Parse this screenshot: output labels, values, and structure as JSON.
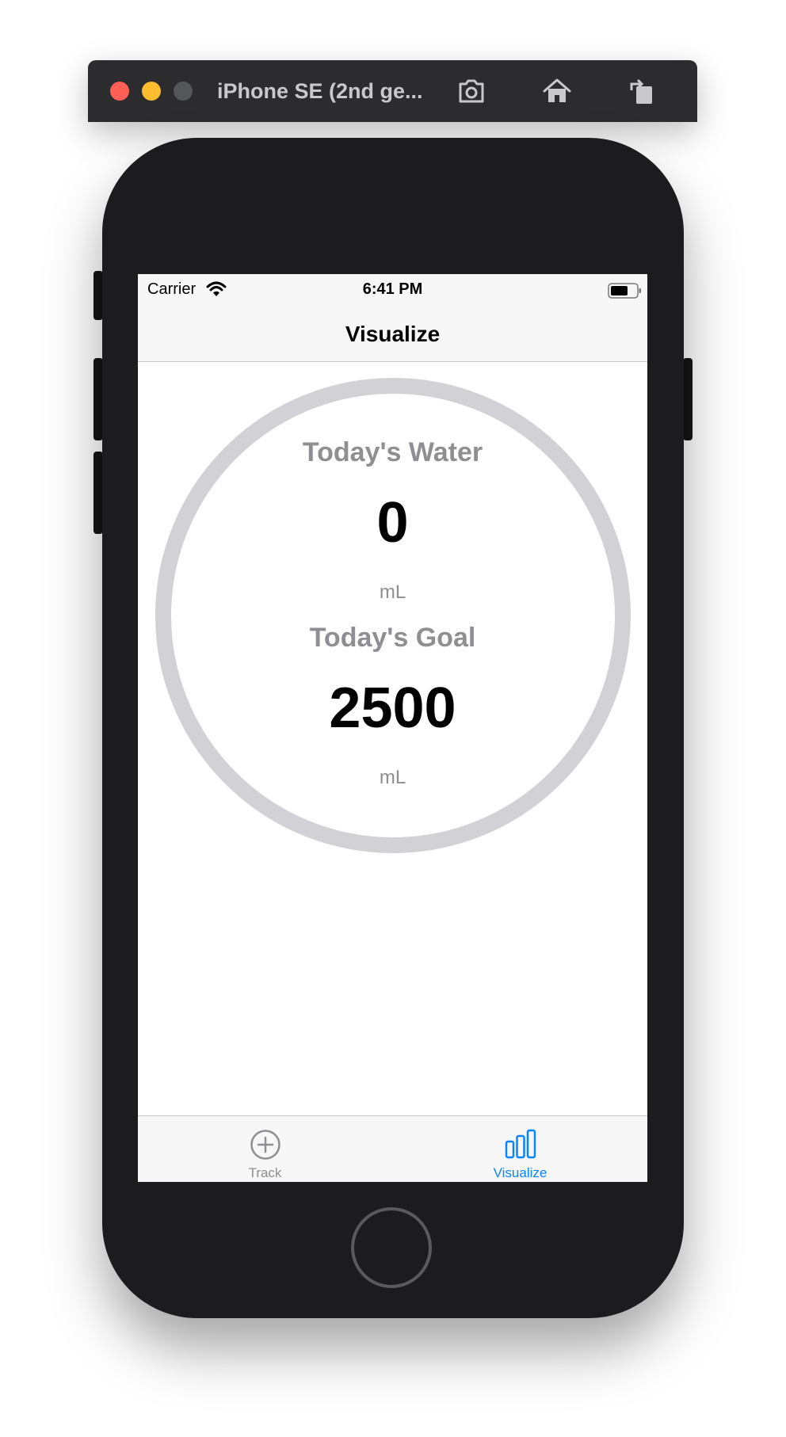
{
  "simulator": {
    "title": "iPhone SE (2nd ge...",
    "toolbar_icons": [
      "screenshot-icon",
      "home-icon",
      "rotate-icon"
    ]
  },
  "status_bar": {
    "carrier": "Carrier",
    "time": "6:41 PM"
  },
  "nav": {
    "title": "Visualize"
  },
  "summary": {
    "water_heading": "Today's Water",
    "water_value": "0",
    "water_unit": "mL",
    "goal_heading": "Today's Goal",
    "goal_value": "2500",
    "goal_unit": "mL",
    "progress_fraction": 0
  },
  "tabs": [
    {
      "label": "Track",
      "icon": "plus-circle-icon",
      "selected": false
    },
    {
      "label": "Visualize",
      "icon": "bar-chart-icon",
      "selected": true
    }
  ],
  "colors": {
    "accent": "#0A84FF",
    "ring": "#D1D1D6",
    "secondary_text": "#8E8E93"
  }
}
